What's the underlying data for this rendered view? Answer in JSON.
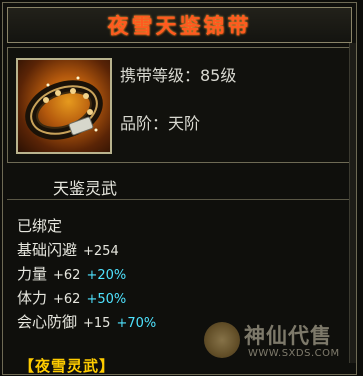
{
  "item": {
    "name": "夜雪天鉴锦带",
    "carry_level": "携带等级：85级",
    "grade": "品阶：天阶",
    "set_title": "天鉴灵武"
  },
  "stats": {
    "bound": "已绑定",
    "lines": [
      {
        "label": "基础闪避",
        "value": "+254",
        "pct": ""
      },
      {
        "label": "力量",
        "value": "+62",
        "pct": "+20%"
      },
      {
        "label": "体力",
        "value": "+62",
        "pct": "+50%"
      },
      {
        "label": "会心防御",
        "value": "+15",
        "pct": "+70%"
      }
    ]
  },
  "section": {
    "label": "【夜雪灵武】"
  },
  "watermark": {
    "text": "神仙代售",
    "url": "WWW.SXDS.COM"
  },
  "colors": {
    "title": "#ff5a1f",
    "percent": "#4fe3ff",
    "section": "#ffcc00",
    "text": "#e6e6de"
  },
  "icons": {
    "item_icon": "belt-icon"
  }
}
